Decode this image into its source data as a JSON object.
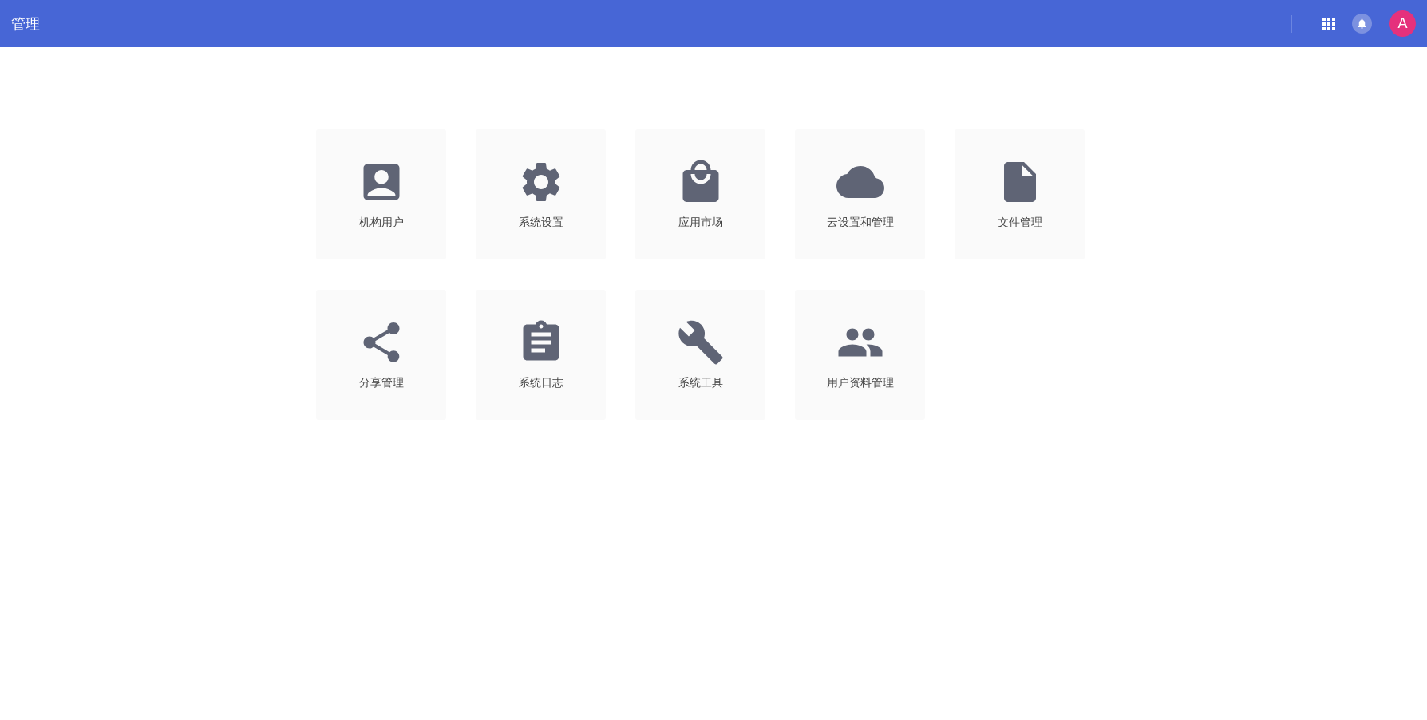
{
  "header": {
    "title": "管理",
    "avatar": "A"
  },
  "tiles": [
    {
      "kind": "account",
      "label": "机构用户"
    },
    {
      "kind": "settings",
      "label": "系统设置"
    },
    {
      "kind": "bag",
      "label": "应用市场"
    },
    {
      "kind": "cloud",
      "label": "云设置和管理"
    },
    {
      "kind": "file",
      "label": "文件管理"
    },
    {
      "kind": "share",
      "label": "分享管理"
    },
    {
      "kind": "clipboard",
      "label": "系统日志"
    },
    {
      "kind": "wrench",
      "label": "系统工具"
    },
    {
      "kind": "people",
      "label": "用户资料管理"
    }
  ]
}
